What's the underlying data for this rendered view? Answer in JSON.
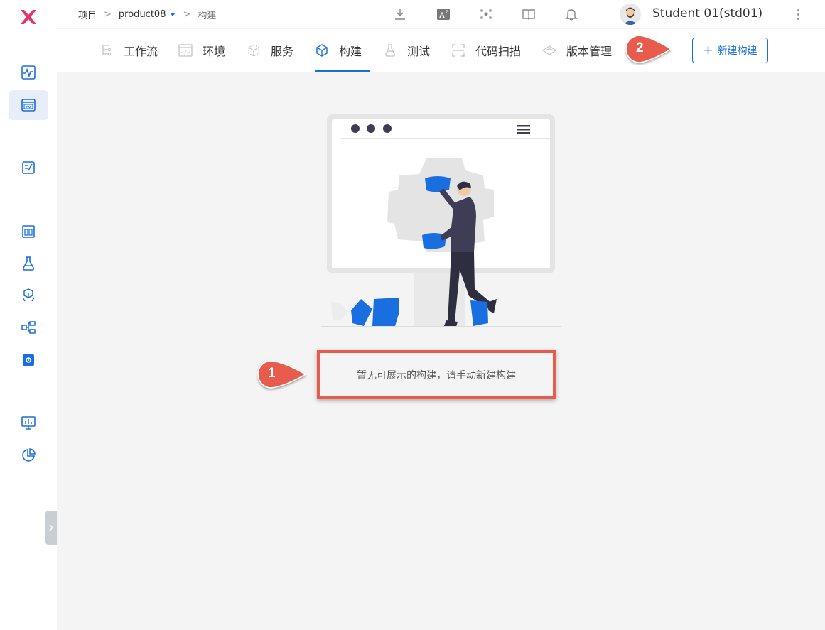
{
  "app": {
    "logo_name": "X"
  },
  "breadcrumb": {
    "root": "项目",
    "separator": ">",
    "project": "product08",
    "current": "构建"
  },
  "user": {
    "name": "Student 01(std01)"
  },
  "tabs": [
    {
      "label": "工作流",
      "icon": "workflow-icon",
      "active": false
    },
    {
      "label": "环境",
      "icon": "environment-icon",
      "active": false
    },
    {
      "label": "服务",
      "icon": "service-icon",
      "active": false
    },
    {
      "label": "构建",
      "icon": "build-icon",
      "active": true
    },
    {
      "label": "测试",
      "icon": "test-icon",
      "active": false
    },
    {
      "label": "代码扫描",
      "icon": "code-scan-icon",
      "active": false
    },
    {
      "label": "版本管理",
      "icon": "version-icon",
      "active": false
    }
  ],
  "actions": {
    "new_build": "新建构建",
    "plus": "+"
  },
  "empty_state": {
    "message": "暂无可展示的构建，请手动新建构建"
  },
  "annotations": {
    "callout_1": "1",
    "callout_2": "2"
  },
  "colors": {
    "accent": "#1a6fe0",
    "callout": "#e85c4d",
    "logo": "#e8326e"
  }
}
